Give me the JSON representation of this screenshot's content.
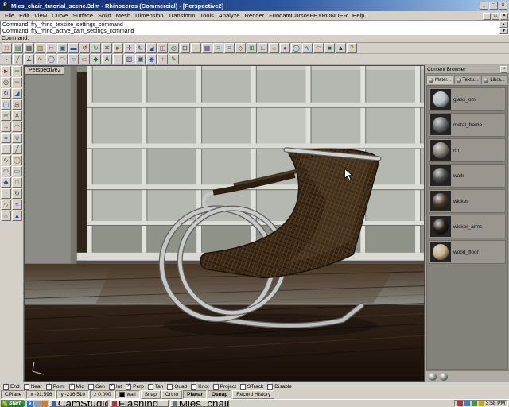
{
  "window": {
    "title": "Mies_chair_tutorial_scene.3dm - Rhinoceros (Commercial) - [Perspective2]",
    "controls": [
      {
        "name": "minimize-button",
        "glyph": "_"
      },
      {
        "name": "maximize-button",
        "glyph": "□"
      },
      {
        "name": "close-button",
        "glyph": "×"
      }
    ]
  },
  "menu": {
    "items": [
      "File",
      "Edit",
      "View",
      "Curve",
      "Surface",
      "Solid",
      "Mesh",
      "Dimension",
      "Transform",
      "Tools",
      "Analyze",
      "Render",
      "FundamCursosFHYRONDER",
      "Help"
    ]
  },
  "command": {
    "history": [
      "Command: fry_rhino_texsize_settings_command",
      "Command: fry_rhino_active_cam_settings_command"
    ],
    "prompt": "Command:",
    "scroll_up": "▲",
    "scroll_down": "▼"
  },
  "toolbar_top": [
    {
      "name": "new-file-icon",
      "glyph": "□"
    },
    {
      "name": "open-file-icon",
      "glyph": "▤"
    },
    {
      "name": "save-file-icon",
      "glyph": "▦"
    },
    {
      "name": "print-icon",
      "glyph": "▥"
    },
    {
      "name": "cut-icon",
      "glyph": "✂"
    },
    {
      "name": "copy-icon",
      "glyph": "▣"
    },
    {
      "name": "paste-icon",
      "glyph": "▬"
    },
    {
      "name": "undo-icon",
      "glyph": "↺"
    },
    {
      "name": "redo-icon",
      "glyph": "↻"
    },
    {
      "name": "delete-icon",
      "glyph": "✕"
    },
    {
      "name": "select-pointer-icon",
      "glyph": "►"
    },
    {
      "name": "move-icon",
      "glyph": "✛"
    },
    {
      "name": "rotate-icon",
      "glyph": "↻"
    },
    {
      "name": "scale-icon",
      "glyph": "◢"
    },
    {
      "name": "mirror-icon",
      "glyph": "◫"
    },
    {
      "name": "zoom-extents-icon",
      "glyph": "◎"
    },
    {
      "name": "zoom-window-icon",
      "glyph": "⊡"
    },
    {
      "name": "pan-view-icon",
      "glyph": "+"
    },
    {
      "name": "named-views-icon",
      "glyph": "▦"
    },
    {
      "name": "layers-icon",
      "glyph": "≡"
    },
    {
      "name": "properties-icon",
      "glyph": "≡"
    },
    {
      "name": "object-snap-icon",
      "glyph": "◇"
    },
    {
      "name": "grid-snap-icon",
      "glyph": "⊞"
    },
    {
      "name": "ortho-mode-icon",
      "glyph": "∟"
    },
    {
      "name": "render-icon",
      "glyph": "☼"
    },
    {
      "name": "shaded-view-icon",
      "glyph": "●"
    },
    {
      "name": "wireframe-view-icon",
      "glyph": "◯"
    },
    {
      "name": "curve-tools-icon",
      "glyph": "∿"
    },
    {
      "name": "surface-tools-icon",
      "glyph": "◠"
    },
    {
      "name": "solid-tools-icon",
      "glyph": "■"
    },
    {
      "name": "mesh-tools-icon",
      "glyph": "▲"
    },
    {
      "name": "help-icon",
      "glyph": "?"
    }
  ],
  "toolbar_second": [
    {
      "name": "single-point-icon",
      "glyph": "·"
    },
    {
      "name": "line-icon",
      "glyph": "╱"
    },
    {
      "name": "polyline-icon",
      "glyph": "∠"
    },
    {
      "name": "interp-curve-icon",
      "glyph": "∿"
    },
    {
      "name": "circle-icon",
      "glyph": "◯"
    },
    {
      "name": "arc-icon",
      "glyph": "◠"
    },
    {
      "name": "ellipse-icon",
      "glyph": "○"
    },
    {
      "name": "rectangle-icon",
      "glyph": "▭"
    },
    {
      "name": "polygon-icon",
      "glyph": "◆"
    },
    {
      "name": "text-object-icon",
      "glyph": "A"
    },
    {
      "name": "dimension-icon",
      "glyph": "↔"
    },
    {
      "name": "hatch-icon",
      "glyph": "▨"
    },
    {
      "name": "block-icon",
      "glyph": "▣"
    },
    {
      "name": "group-icon",
      "glyph": "◉"
    },
    {
      "name": "extrude-icon",
      "glyph": "↑"
    },
    {
      "name": "annotate-pencil-icon",
      "glyph": "✎"
    }
  ],
  "toolbar_left": [
    {
      "name": "pointer-tool-icon",
      "glyph": "►"
    },
    {
      "name": "pan-tool-icon",
      "glyph": "✛"
    },
    {
      "name": "zoom-tool-icon",
      "glyph": "◎"
    },
    {
      "name": "move-tool-icon",
      "glyph": "✛"
    },
    {
      "name": "rotate-tool-icon",
      "glyph": "↻"
    },
    {
      "name": "scale-tool-icon",
      "glyph": "◢"
    },
    {
      "name": "mirror-tool-icon",
      "glyph": "◫"
    },
    {
      "name": "array-tool-icon",
      "glyph": "⊞"
    },
    {
      "name": "trim-tool-icon",
      "glyph": "✂"
    },
    {
      "name": "split-tool-icon",
      "glyph": "✕"
    },
    {
      "name": "extend-tool-icon",
      "glyph": "→"
    },
    {
      "name": "fillet-tool-icon",
      "glyph": "◠"
    },
    {
      "name": "offset-tool-icon",
      "glyph": "="
    },
    {
      "name": "blend-tool-icon",
      "glyph": "∪"
    },
    {
      "name": "point-tool-icon",
      "glyph": "·"
    },
    {
      "name": "line-tool-icon",
      "glyph": "╱"
    },
    {
      "name": "curve-tool-icon",
      "glyph": "∿"
    },
    {
      "name": "circle-tool-icon",
      "glyph": "◯"
    },
    {
      "name": "arc-tool-icon",
      "glyph": "◠"
    },
    {
      "name": "rectangle-tool-icon",
      "glyph": "▭"
    },
    {
      "name": "polygon-tool-icon",
      "glyph": "◆"
    },
    {
      "name": "surface-tool-icon",
      "glyph": "□"
    },
    {
      "name": "extrude-tool-icon",
      "glyph": "↑"
    },
    {
      "name": "revolve-tool-icon",
      "glyph": "↻"
    },
    {
      "name": "sweep-tool-icon",
      "glyph": "∿"
    },
    {
      "name": "loft-tool-icon",
      "glyph": "≈"
    },
    {
      "name": "boolean-tool-icon",
      "glyph": "∩"
    },
    {
      "name": "mesh-tool-icon",
      "glyph": "▲"
    }
  ],
  "viewport": {
    "label": "Perspective2"
  },
  "content_browser": {
    "title": "Content Browser",
    "close_glyph": "×",
    "tabs": [
      {
        "label": "Mater...",
        "active": true
      },
      {
        "label": "Textu..."
      },
      {
        "label": "Libra..."
      }
    ],
    "materials": [
      {
        "name": "glass_om",
        "color": "#b9c2c6"
      },
      {
        "name": "metal_frame",
        "color": "#6a6c74"
      },
      {
        "name": "rim",
        "color": "#8a8076"
      },
      {
        "name": "walls",
        "color": "#4a4a48"
      },
      {
        "name": "wicker",
        "color": "#4a3826"
      },
      {
        "name": "wicker_arms",
        "color": "#241a12"
      },
      {
        "name": "wood_floor",
        "color": "#c8b28a"
      }
    ]
  },
  "osnap": {
    "items": [
      {
        "label": "End",
        "checked": true
      },
      {
        "label": "Near",
        "checked": false
      },
      {
        "label": "Point",
        "checked": true
      },
      {
        "label": "Mid",
        "checked": true
      },
      {
        "label": "Cen",
        "checked": false
      },
      {
        "label": "Int",
        "checked": true
      },
      {
        "label": "Perp",
        "checked": true
      },
      {
        "label": "Tan",
        "checked": false
      },
      {
        "label": "Quad",
        "checked": false
      },
      {
        "label": "Knot",
        "checked": false
      },
      {
        "label": "Project",
        "checked": false
      },
      {
        "label": "STrack",
        "checked": false
      },
      {
        "label": "Disable",
        "checked": false
      }
    ]
  },
  "status": {
    "cplane": "CPlane",
    "x": "x -91.596",
    "y": "y -216.510",
    "z": "z 0.000",
    "layer": "wall",
    "layer_color": "#000000",
    "panes": [
      {
        "name": "snap-pane",
        "label": "Snap"
      },
      {
        "name": "ortho-pane",
        "label": "Ortho"
      },
      {
        "name": "planar-pane",
        "label": "Planar",
        "active": true
      },
      {
        "name": "osnap-pane",
        "label": "Osnap",
        "active": true
      },
      {
        "name": "record-history-pane",
        "label": "Record History"
      }
    ]
  },
  "taskbar": {
    "start": "Start",
    "quick_launch": [
      {
        "name": "internet-explorer-quicklaunch-icon",
        "glyph": "e",
        "color": "#2a6fd6"
      },
      {
        "name": "show-desktop-quicklaunch-icon",
        "glyph": "",
        "color": "#8a99b5"
      },
      {
        "name": "media-player-quicklaunch-icon",
        "glyph": "",
        "color": "#d67f2a"
      }
    ],
    "tasks": [
      {
        "label": "CamStudio",
        "icon_color": "#4060a0"
      },
      {
        "label": "Flashing",
        "icon_color": "#c03030"
      },
      {
        "label": "Mies_chair_tutorial_scen...",
        "icon_color": "#707070"
      }
    ],
    "tray_icons": [
      {
        "name": "recorder-tray-icon",
        "color": "#c03030"
      },
      {
        "name": "volume-tray-icon",
        "color": "#4a7ac0"
      },
      {
        "name": "network-tray-icon",
        "color": "#3a9a4a"
      },
      {
        "name": "update-tray-icon",
        "color": "#d0a020"
      }
    ],
    "time": "3:58 PM"
  }
}
